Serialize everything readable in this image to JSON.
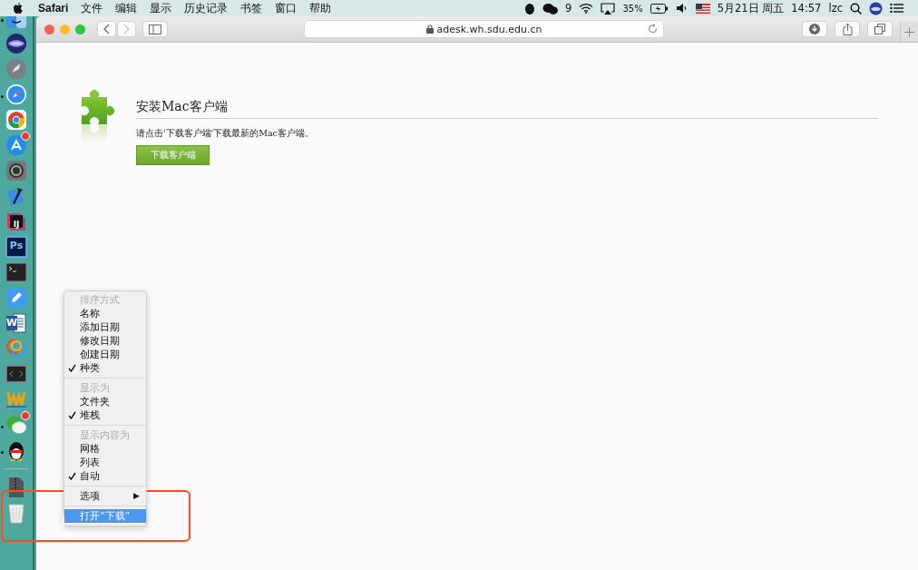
{
  "menubar": {
    "app": "Safari",
    "menus": [
      "文件",
      "编辑",
      "显示",
      "历史记录",
      "书签",
      "窗口",
      "帮助"
    ],
    "status": {
      "wechat_count": "9",
      "battery": "35%",
      "date": "5月21日 周五",
      "time": "14:57",
      "user": "lzc"
    }
  },
  "dock": {
    "items": [
      {
        "kind": "finder",
        "running": true
      },
      {
        "kind": "siri",
        "running": false
      },
      {
        "kind": "launchpad",
        "running": false
      },
      {
        "kind": "safari",
        "running": true
      },
      {
        "kind": "chrome",
        "running": false
      },
      {
        "kind": "appstore",
        "running": false,
        "badge": true
      },
      {
        "kind": "settings",
        "running": false
      },
      {
        "kind": "xcode",
        "running": false
      },
      {
        "kind": "intellij",
        "running": false,
        "label": "IJ"
      },
      {
        "kind": "photoshop",
        "running": false,
        "label": "Ps"
      },
      {
        "kind": "terminal",
        "running": false
      },
      {
        "kind": "pencil",
        "running": false
      },
      {
        "kind": "word",
        "running": false,
        "label": "W"
      },
      {
        "kind": "navicat",
        "running": false
      },
      {
        "kind": "code",
        "running": false
      },
      {
        "kind": "wave",
        "running": false
      },
      {
        "kind": "wechat",
        "running": true,
        "badge": true
      },
      {
        "kind": "qq",
        "running": true
      },
      {
        "kind": "separator"
      },
      {
        "kind": "downloads",
        "running": false
      },
      {
        "kind": "trash",
        "running": false
      }
    ]
  },
  "browser": {
    "back_disabled": false,
    "forward_disabled": true,
    "url": "adesk.wh.sdu.edu.cn"
  },
  "page": {
    "title": "安装Mac客户端",
    "text": "请点击'下载客户端'下载最新的Mac客户端。",
    "button": "下载客户端"
  },
  "context_menu": {
    "sections": [
      {
        "header": "排序方式",
        "items": [
          {
            "label": "名称",
            "checked": false
          },
          {
            "label": "添加日期",
            "checked": false
          },
          {
            "label": "修改日期",
            "checked": false
          },
          {
            "label": "创建日期",
            "checked": false
          },
          {
            "label": "种类",
            "checked": true
          }
        ]
      },
      {
        "header": "显示为",
        "items": [
          {
            "label": "文件夹",
            "checked": false
          },
          {
            "label": "堆栈",
            "checked": true
          }
        ]
      },
      {
        "header": "显示内容为",
        "items": [
          {
            "label": "网格",
            "checked": false
          },
          {
            "label": "列表",
            "checked": false
          },
          {
            "label": "自动",
            "checked": true
          }
        ]
      }
    ],
    "submenu_item": {
      "label": "选项",
      "arrow": "▶"
    },
    "actions": [
      {
        "label": "打开“下载”",
        "selected": true
      }
    ]
  },
  "highlight_frame": true
}
